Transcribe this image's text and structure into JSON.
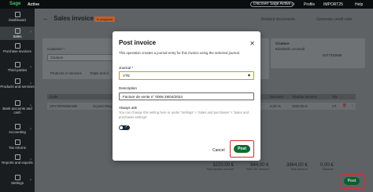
{
  "topbar": {
    "logo": "Sage",
    "env": "Active",
    "discover": "Discover Sage Active",
    "help_label": "Help",
    "people_label": "People",
    "profile": "Profile",
    "company": "IMPORT25",
    "help": "Help"
  },
  "sidebar": {
    "items": [
      {
        "label": "Dashboard"
      },
      {
        "label": "Sales"
      },
      {
        "label": "Purchase invoices"
      },
      {
        "label": "Third parties"
      },
      {
        "label": "Products and services"
      },
      {
        "label": "Bank accounts and cash"
      },
      {
        "label": "Accounting"
      },
      {
        "label": "Tax returns"
      },
      {
        "label": "Reports and exports"
      },
      {
        "label": "Settings"
      }
    ]
  },
  "main": {
    "back": "←",
    "title": "Sales invoice",
    "badge": "In progress",
    "related": "Related documents",
    "credit": "Generate credit note",
    "customer_label": "Customer *",
    "customer_value": "Cisature",
    "tab_products": "Products or services",
    "tab_totals": "Totals and d",
    "col_code": "Code",
    "col_discount": "Discount",
    "col_taxable": "Taxable amount",
    "col_tax": "Tax",
    "row_code": "CRYSRINGBAND",
    "row_desc": "Crystal Ring Ban",
    "row_discount": "0,00 %",
    "row_taxable": "3220,00 €",
    "row_tax": "VT",
    "client_name": "Cisature",
    "client_contact": "Elizabeth Lecureuil",
    "client_phone": "0477332588",
    "totals": [
      {
        "value": "3220,00 €",
        "label": "Total taxable amount"
      },
      {
        "value": "644,00 €",
        "label": "Total VAT amount"
      },
      {
        "value": "3864,00 €",
        "label": "Total amount"
      },
      {
        "value": "0,00 €",
        "label": "Balance"
      }
    ],
    "post_label": "Post"
  },
  "modal": {
    "title": "Post invoice",
    "description": "This operation creates a journal entry for this invoice using the selected journal.",
    "journal_label": "Journal *",
    "journal_value": "VTE",
    "desc_label": "Description",
    "desc_value": "Facture de vente n° 0008 29/04/2024",
    "always_ask": "Always ask",
    "note": "You can change this setting here or under 'Settings' > 'Sales and purchases' > 'Sales and purchases settings'.",
    "cancel": "Cancel",
    "post": "Post"
  },
  "colors": {
    "brand_green": "#0f6b32",
    "highlight_red": "#d92b2b",
    "select_focus": "#c8a000"
  }
}
